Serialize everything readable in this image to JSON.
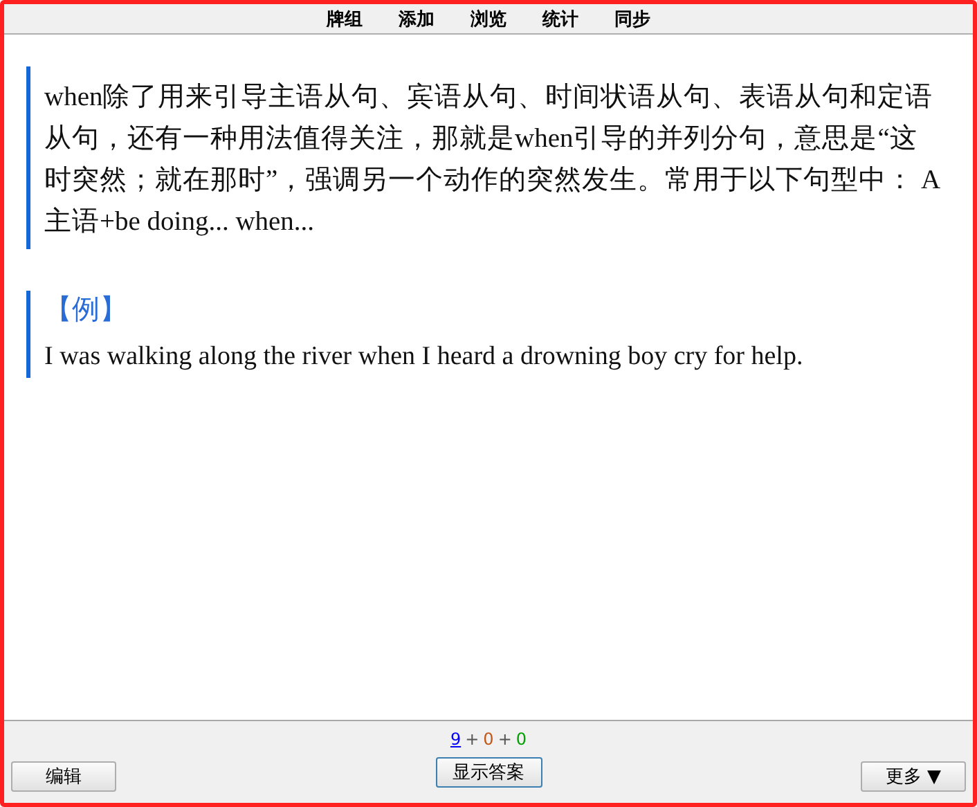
{
  "menu": [
    "牌组",
    "添加",
    "浏览",
    "统计",
    "同步"
  ],
  "question": {
    "text": "when除了用来引导主语从句、宾语从句、时间状语从句、表语从句和定语从句，还有一种用法值得关注，那就是when引导的并列分句，意思是“这时突然；就在那时”，强调另一个动作的突然发生。常用于以下句型中： A 主语+be doing... when..."
  },
  "example": {
    "heading": "【例】",
    "text": "I was walking along the river when I heard a drowning boy cry for help."
  },
  "count_separator": "+",
  "counts": [
    {
      "value": "9",
      "color": "#0000ff",
      "selected": true
    },
    {
      "value": "0",
      "color": "#c35617",
      "selected": false
    },
    {
      "value": "0",
      "color": "#00a000",
      "selected": false
    }
  ],
  "buttons": {
    "edit": "编辑",
    "show_answer": "显示答案",
    "more": "更多 ▼"
  }
}
